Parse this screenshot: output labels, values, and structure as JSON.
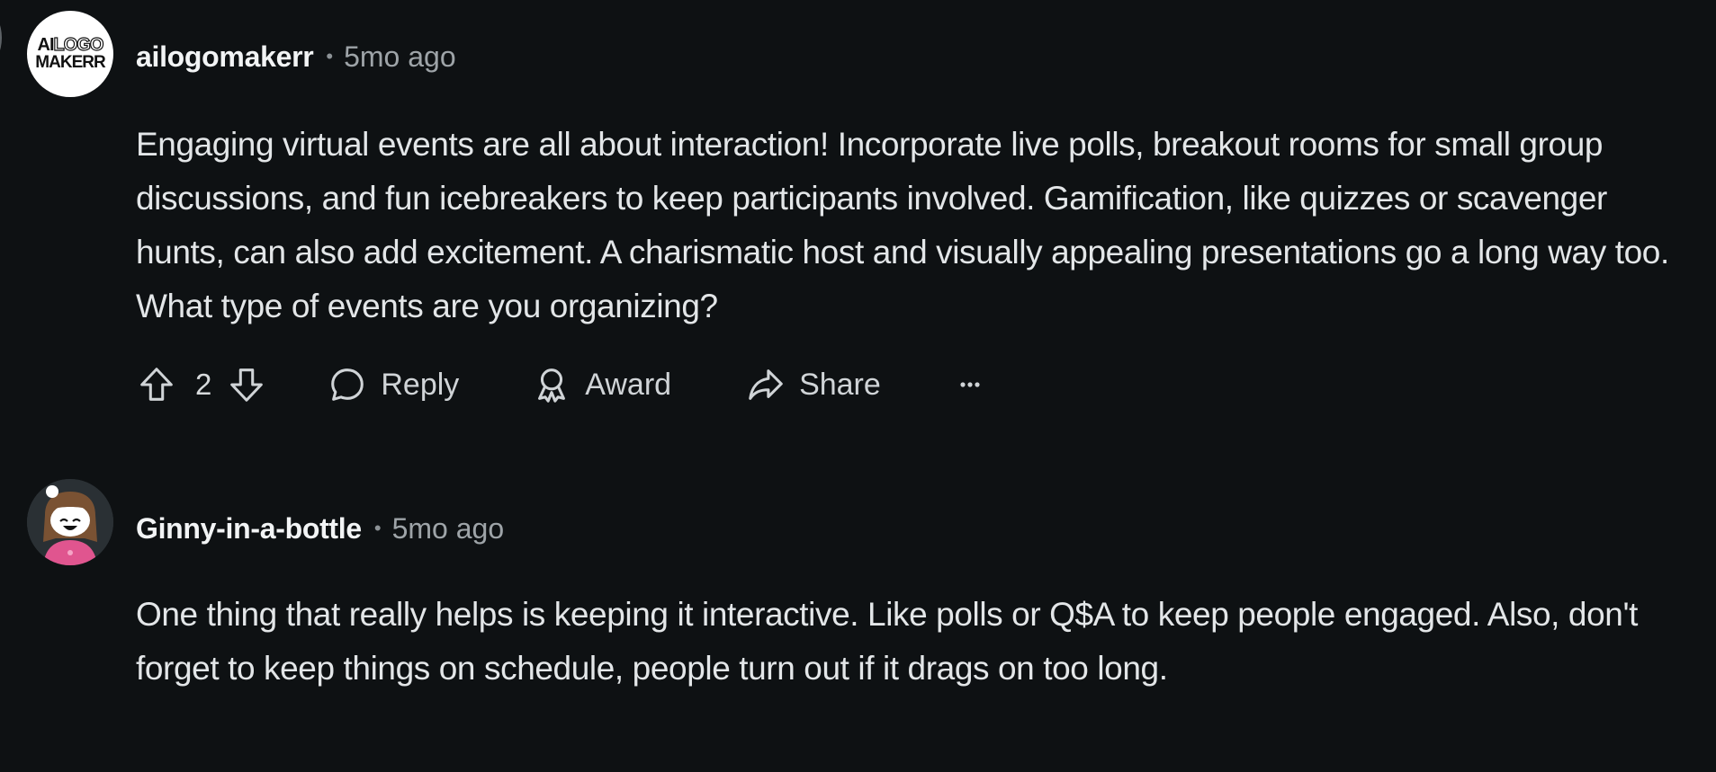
{
  "comments": [
    {
      "username": "ailogomakerr",
      "separator": "•",
      "time": "5mo ago",
      "avatar": {
        "line1_a": "AI",
        "line1_b": "LOGO",
        "line2": "MAKERR"
      },
      "body": "Engaging virtual events are all about interaction! Incorporate live polls, breakout rooms for small group discussions, and fun icebreakers to keep participants involved. Gamification, like quizzes or scavenger hunts, can also add excitement. A charismatic host and visually appealing presentations go a long way too. What type of events are you organizing?",
      "actions": {
        "vote_count": "2",
        "reply_label": "Reply",
        "award_label": "Award",
        "share_label": "Share",
        "more_label": "•••"
      }
    },
    {
      "username": "Ginny-in-a-bottle",
      "separator": "•",
      "time": "5mo ago",
      "body": "One thing that really helps is keeping it interactive. Like polls or Q$A to keep people engaged. Also, don't forget to keep things on schedule, people turn out if it drags on too long."
    }
  ],
  "icons": [
    "upvote-icon",
    "downvote-icon",
    "comment-bubble-icon",
    "award-icon",
    "share-arrow-icon",
    "more-options-icon"
  ],
  "colors": {
    "background": "#0e1113",
    "text": "#e3e6e8",
    "muted": "#9ea4a8",
    "avatar_accent": "#e0558f"
  }
}
